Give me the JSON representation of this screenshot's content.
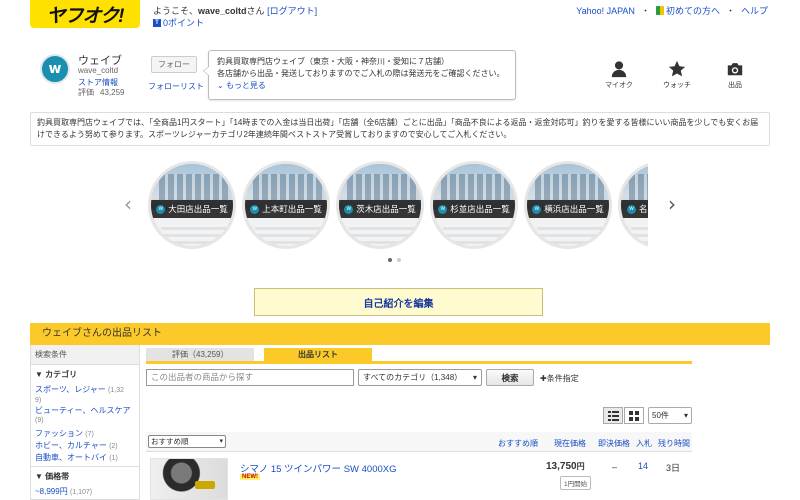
{
  "header": {
    "logo": "ヤフオク!",
    "welcome_prefix": "ようこそ、",
    "username": "wave_coltd",
    "welcome_suffix": "さん",
    "logout": "[ログアウト]",
    "points": "0ポイント",
    "nav": [
      "Yahoo! JAPAN",
      "初めての方へ",
      "ヘルプ"
    ]
  },
  "store": {
    "name": "ウェイブ",
    "id": "wave_coltd",
    "info_link": "ストア情報",
    "rating_label": "評価",
    "rating_count": "43,259",
    "follow_button": "フォロー",
    "follow_list": "フォローリスト",
    "bubble_line1": "釣具買取専門店ウェイブ（東京・大阪・神奈川・愛知に７店舗）",
    "bubble_line2": "各店舗から出品・発送しておりますのでご入札の際は発送元をご確認ください。",
    "bubble_more": "もっと見る",
    "icons": [
      {
        "icon": "person-icon",
        "label": "マイオク"
      },
      {
        "icon": "star-icon",
        "label": "ウォッチ"
      },
      {
        "icon": "camera-icon",
        "label": "出品"
      }
    ]
  },
  "description": "釣具買取専門店ウェイブでは、「全商品1円スタート」「14時までの入金は当日出荷」「店舗（全6店舗）ごとに出品」「商品不良による返品・返金対応可」釣りを愛する皆様にいい商品を少しでも安くお届けできるよう努めて参ります。スポーツレジャーカテゴリ2年連続年間ベストストア受賞しておりますので安心してご入札ください。",
  "carousel": {
    "items": [
      "大田店出品一覧",
      "上本町出品一覧",
      "茨木店出品一覧",
      "杉並店出品一覧",
      "横浜店出品一覧",
      "名古"
    ],
    "prev": "‹",
    "next": "›"
  },
  "intro_button": "自己紹介を編集",
  "listing_bar": "ウェイブさんの出品リスト",
  "sidebar": {
    "header": "検索条件",
    "category_title": "カテゴリ",
    "categories": [
      {
        "label": "スポーツ、レジャー",
        "count": "(1,32"
      },
      {
        "label": "ビューティー、ヘルスケア",
        "count": "(9)"
      },
      {
        "label": "ファッション",
        "count": "(7)"
      },
      {
        "label": "ホビー、カルチャー",
        "count": "(2)"
      },
      {
        "label": "自動車、オートバイ",
        "count": "(1)"
      }
    ],
    "category_overflow": "9)",
    "price_title": "価格帯",
    "price_item": {
      "label": "~8,999円",
      "count": "(1,107)"
    }
  },
  "tabs": {
    "rating": "評価（43,259）",
    "listings": "出品リスト"
  },
  "search": {
    "placeholder": "この出品者の商品から探す",
    "category_value": "すべてのカテゴリ（1,348）",
    "button": "検索",
    "conditions": "条件指定"
  },
  "per_page": "50件",
  "sort": {
    "selected": "おすすめ順",
    "columns": [
      "おすすめ順",
      "現在価格",
      "即決価格",
      "入札",
      "残り時間"
    ]
  },
  "items": [
    {
      "title": "シマノ 15 ツインパワー SW 4000XG",
      "new_badge": "NEW!",
      "price": "13,750",
      "yen": "円",
      "start_badge": "1円開始",
      "buyout": "–",
      "bids": "14",
      "remaining": "3日"
    }
  ],
  "colors": {
    "brand_yellow": "#ffe100",
    "bar_yellow": "#fcca28",
    "link_blue": "#1a4ec6",
    "store_teal": "#1a8fb0"
  }
}
